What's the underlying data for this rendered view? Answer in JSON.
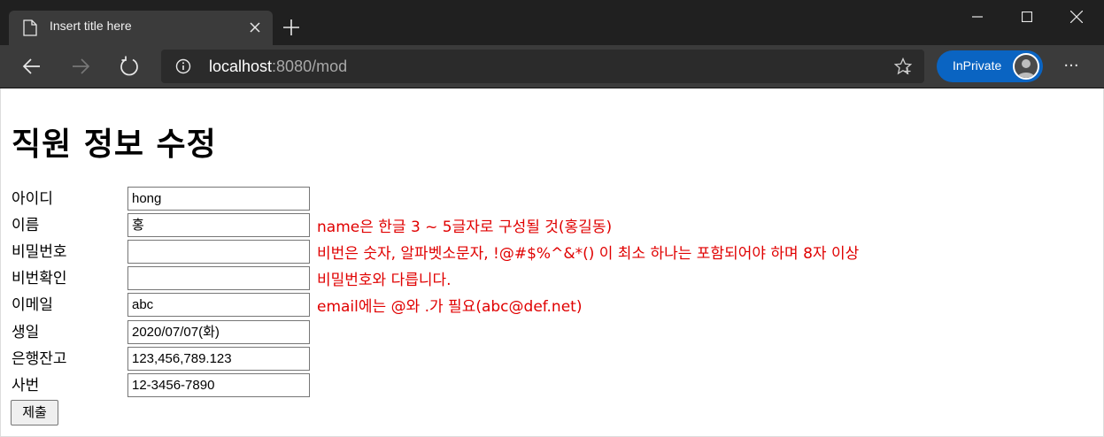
{
  "browser": {
    "tab_title": "Insert title here",
    "url_host": "localhost",
    "url_rest": ":8080/mod",
    "inprivate_label": "InPrivate",
    "more_label": "···"
  },
  "page": {
    "title": "직원 정보 수정",
    "fields": [
      {
        "label": "아이디",
        "value": "hong",
        "error": ""
      },
      {
        "label": "이름",
        "value": "홍",
        "error": "name은 한글 3 ~ 5글자로 구성될 것(홍길동)"
      },
      {
        "label": "비밀번호",
        "value": "",
        "error": "비번은 숫자, 알파벳소문자, !@#$%^&*() 이 최소 하나는 포함되어야 하며 8자 이상"
      },
      {
        "label": "비번확인",
        "value": "",
        "error": "비밀번호와 다릅니다."
      },
      {
        "label": "이메일",
        "value": "abc",
        "error": "email에는 @와 .가 필요(abc@def.net)"
      },
      {
        "label": "생일",
        "value": "2020/07/07(화)",
        "error": ""
      },
      {
        "label": "은행잔고",
        "value": "123,456,789.123",
        "error": ""
      },
      {
        "label": "사번",
        "value": "12-3456-7890",
        "error": ""
      }
    ],
    "submit_label": "제출"
  },
  "colors": {
    "error": "#e00000",
    "inprivate": "#0a64c2",
    "titlebar": "#202020",
    "toolbar": "#3b3b3b"
  }
}
